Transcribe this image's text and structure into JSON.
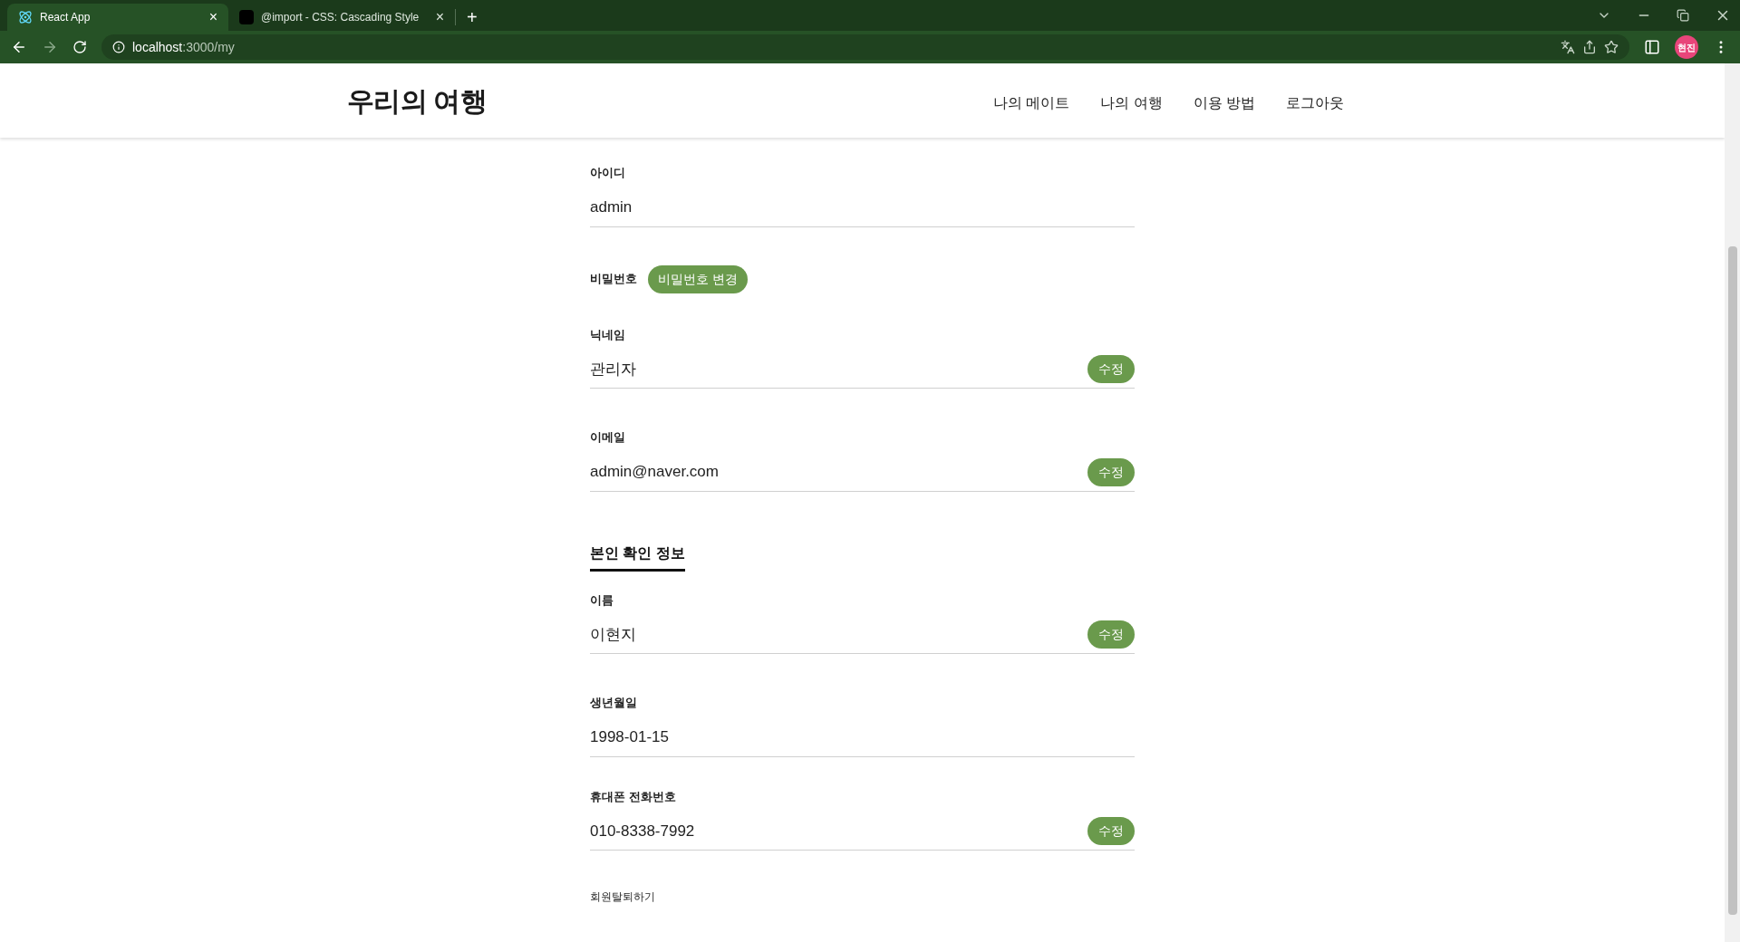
{
  "browser": {
    "tabs": [
      {
        "title": "React App",
        "selected": true,
        "close": "×"
      },
      {
        "title": "@import - CSS: Cascading Style",
        "selected": false,
        "close": "×"
      }
    ],
    "new_tab": "+",
    "url_host": "localhost",
    "url_path": ":3000/my",
    "profile": "현진"
  },
  "header": {
    "logo": "우리의 여행",
    "nav": [
      "나의 메이트",
      "나의 여행",
      "이용 방법",
      "로그아웃"
    ]
  },
  "sections": [
    {
      "fields": [
        {
          "label": "아이디",
          "value": "admin"
        },
        {
          "label": "비밀번호",
          "kind": "button",
          "button": "비밀번호 변경"
        },
        {
          "label": "닉네임",
          "value": "관리자",
          "edit": "수정"
        },
        {
          "label": "이메일",
          "value": "admin@naver.com",
          "edit": "수정"
        }
      ]
    },
    {
      "title": "본인 확인 정보",
      "fields": [
        {
          "label": "이름",
          "value": "이현지",
          "edit": "수정"
        },
        {
          "label": "생년월일",
          "value": "1998-01-15"
        },
        {
          "label": "휴대폰 전화번호",
          "value": "010-8338-7992",
          "edit": "수정"
        }
      ]
    }
  ],
  "withdraw": "회원탈퇴하기"
}
